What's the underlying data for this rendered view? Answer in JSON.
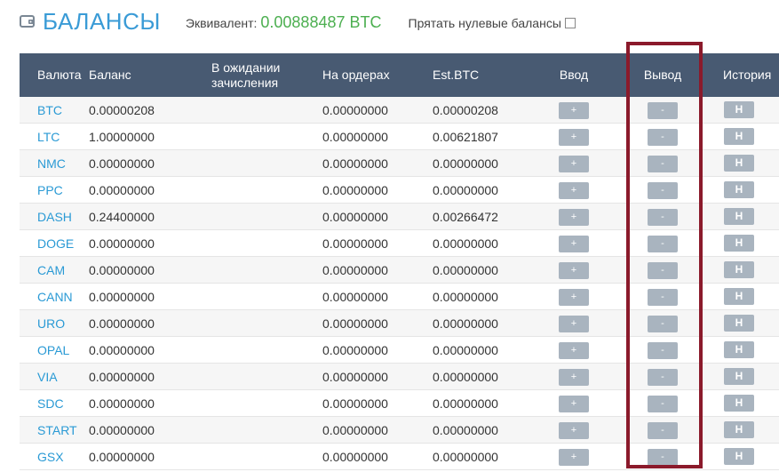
{
  "header": {
    "title": "БАЛАНСЫ",
    "equiv_label": "Эквивалент:",
    "equiv_value": "0.00888487 BTC",
    "hide_zero_label": "Прятать нулевые балансы"
  },
  "table": {
    "columns": {
      "currency": "Валюта",
      "balance": "Баланс",
      "pending": "В ожидании зачисления",
      "orders": "На ордерах",
      "est_btc": "Est.BTC",
      "deposit": "Ввод",
      "withdraw": "Вывод",
      "history": "История"
    },
    "buttons": {
      "deposit": "+",
      "withdraw": "-",
      "history": "H"
    },
    "rows": [
      {
        "currency": "BTC",
        "balance": "0.00000208",
        "pending": "",
        "orders": "0.00000000",
        "est_btc": "0.00000208"
      },
      {
        "currency": "LTC",
        "balance": "1.00000000",
        "pending": "",
        "orders": "0.00000000",
        "est_btc": "0.00621807"
      },
      {
        "currency": "NMC",
        "balance": "0.00000000",
        "pending": "",
        "orders": "0.00000000",
        "est_btc": "0.00000000"
      },
      {
        "currency": "PPC",
        "balance": "0.00000000",
        "pending": "",
        "orders": "0.00000000",
        "est_btc": "0.00000000"
      },
      {
        "currency": "DASH",
        "balance": "0.24400000",
        "pending": "",
        "orders": "0.00000000",
        "est_btc": "0.00266472"
      },
      {
        "currency": "DOGE",
        "balance": "0.00000000",
        "pending": "",
        "orders": "0.00000000",
        "est_btc": "0.00000000"
      },
      {
        "currency": "CAM",
        "balance": "0.00000000",
        "pending": "",
        "orders": "0.00000000",
        "est_btc": "0.00000000"
      },
      {
        "currency": "CANN",
        "balance": "0.00000000",
        "pending": "",
        "orders": "0.00000000",
        "est_btc": "0.00000000"
      },
      {
        "currency": "URO",
        "balance": "0.00000000",
        "pending": "",
        "orders": "0.00000000",
        "est_btc": "0.00000000"
      },
      {
        "currency": "OPAL",
        "balance": "0.00000000",
        "pending": "",
        "orders": "0.00000000",
        "est_btc": "0.00000000"
      },
      {
        "currency": "VIA",
        "balance": "0.00000000",
        "pending": "",
        "orders": "0.00000000",
        "est_btc": "0.00000000"
      },
      {
        "currency": "SDC",
        "balance": "0.00000000",
        "pending": "",
        "orders": "0.00000000",
        "est_btc": "0.00000000"
      },
      {
        "currency": "START",
        "balance": "0.00000000",
        "pending": "",
        "orders": "0.00000000",
        "est_btc": "0.00000000"
      },
      {
        "currency": "GSX",
        "balance": "0.00000000",
        "pending": "",
        "orders": "0.00000000",
        "est_btc": "0.00000000"
      }
    ]
  },
  "icons": {
    "title_icon": "wallet-icon"
  },
  "colors": {
    "title": "#3a9bd6",
    "equiv_value": "#4caf50",
    "header_bg": "#485a72",
    "button_bg": "#a9b4bf",
    "highlight": "#8b1a2b",
    "link": "#2a9ad5"
  }
}
